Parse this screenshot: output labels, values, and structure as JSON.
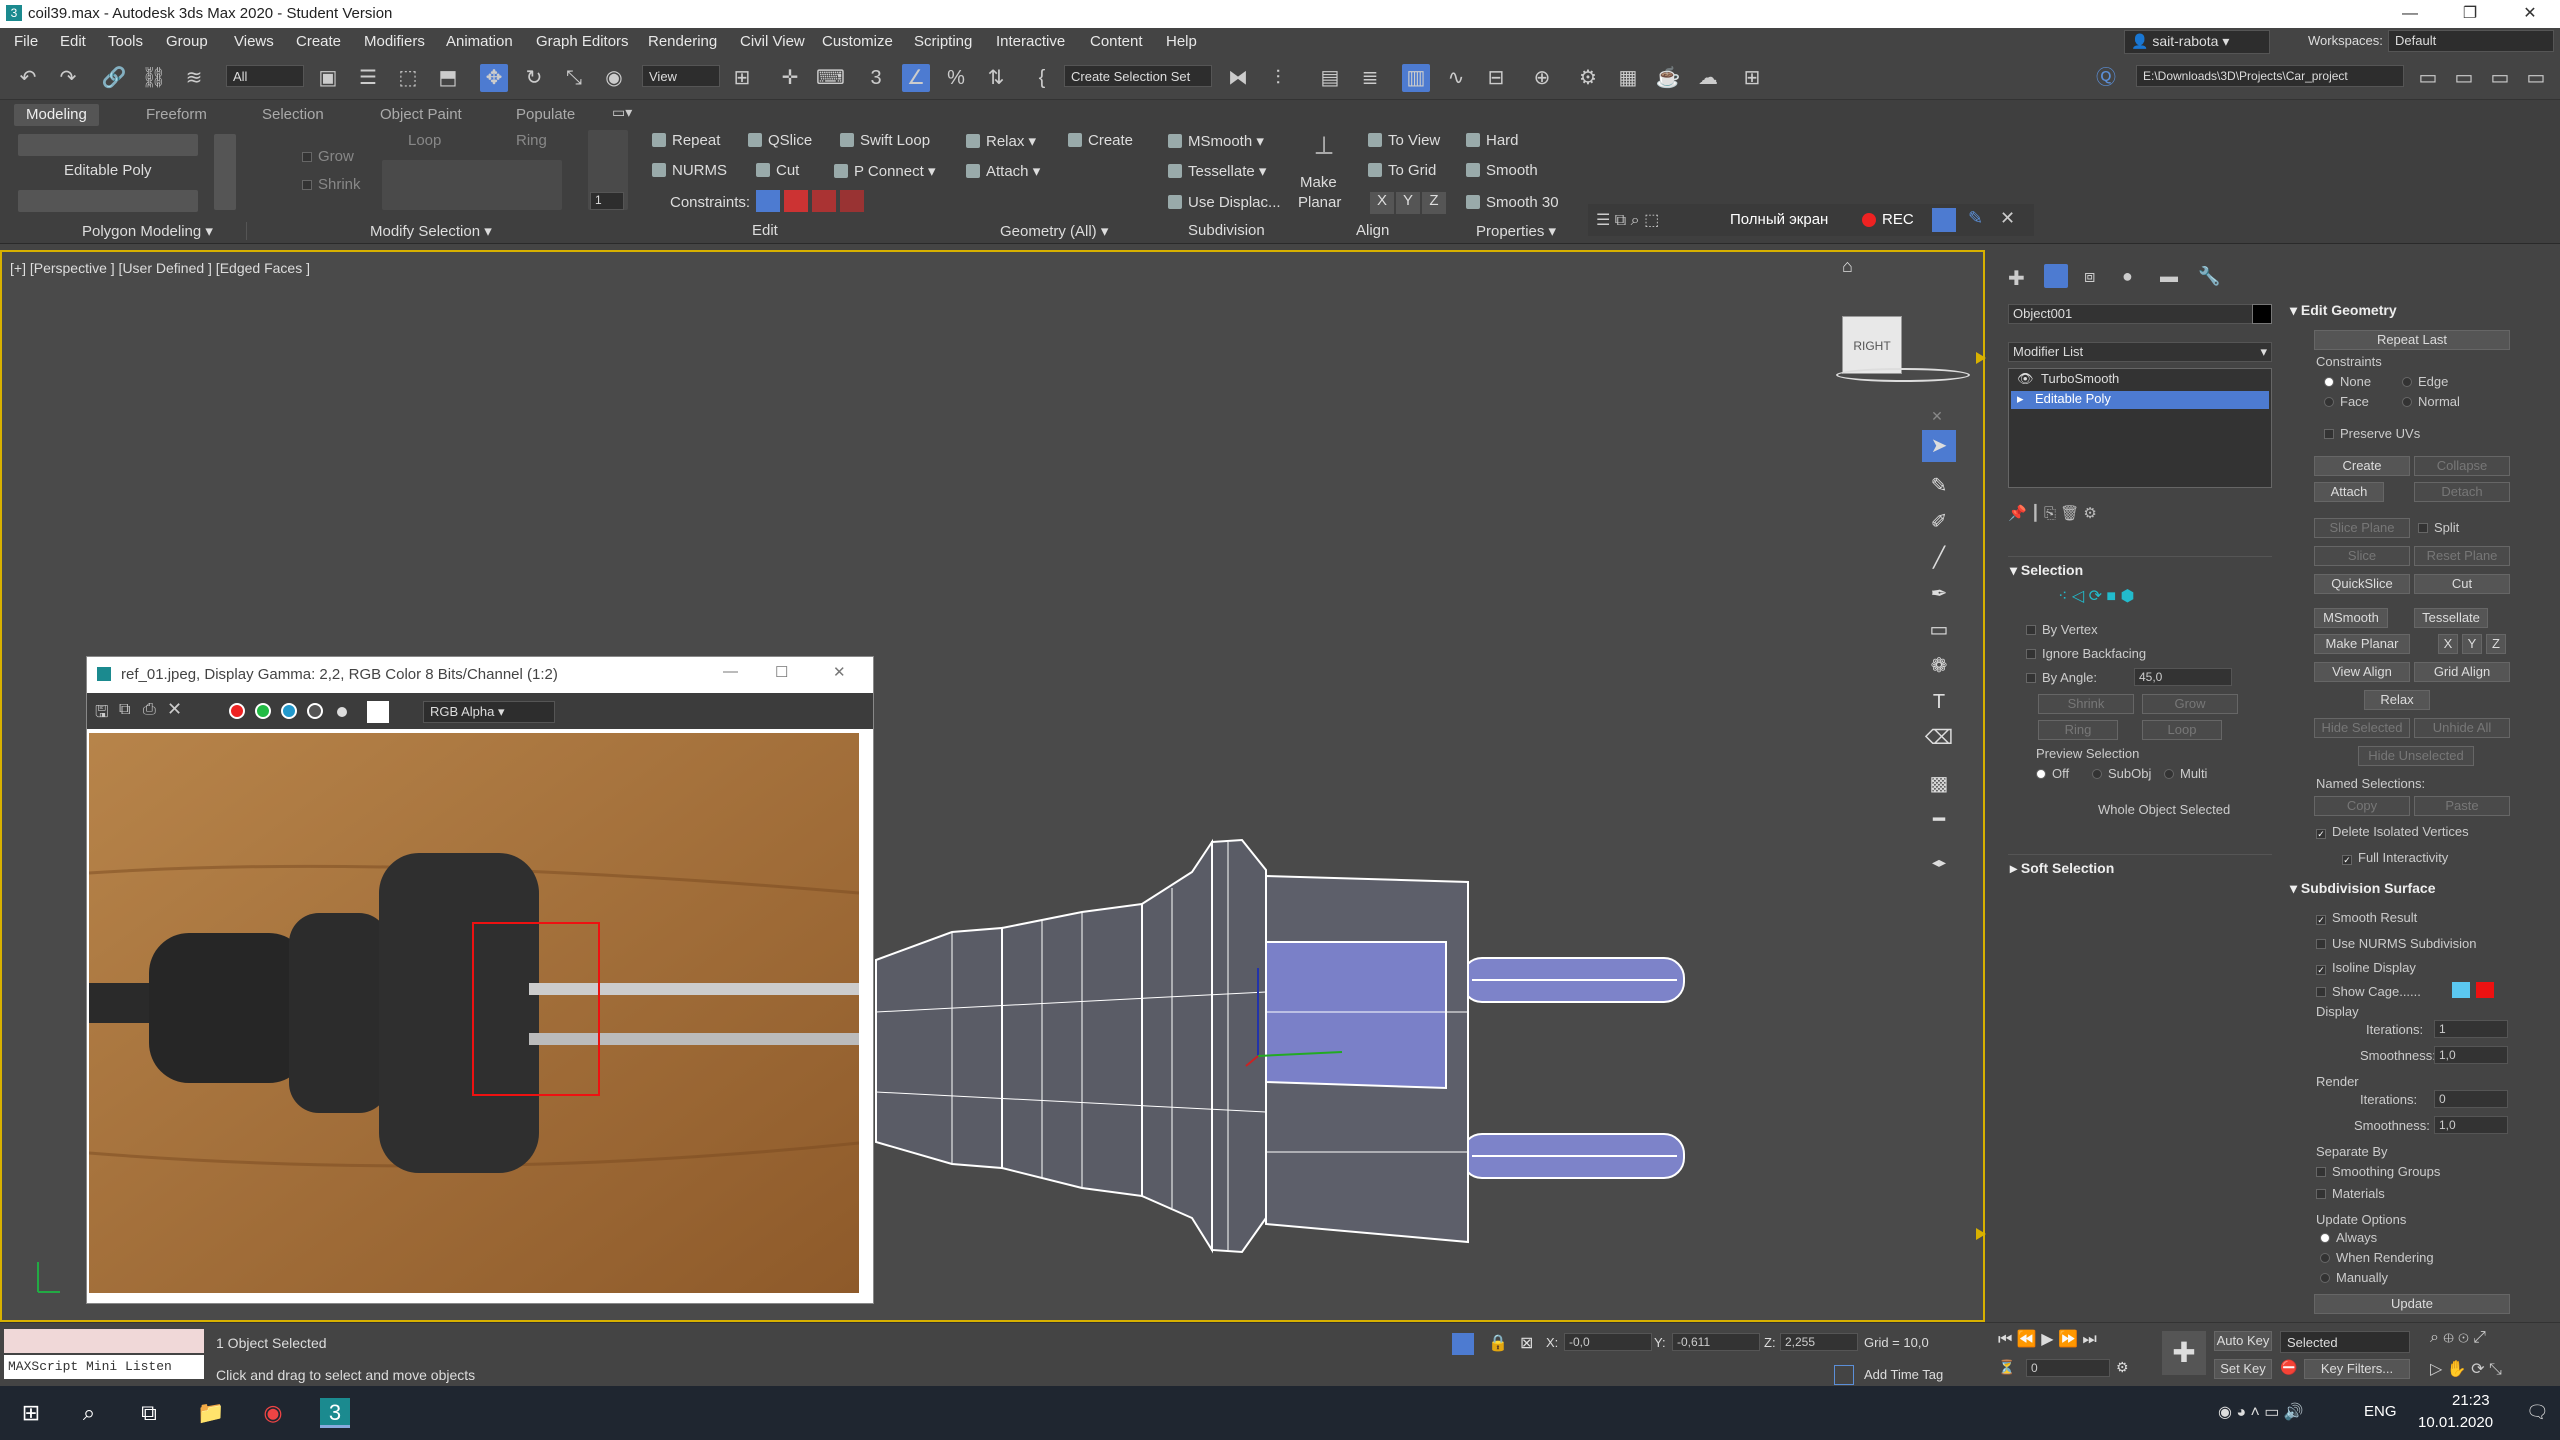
{
  "window": {
    "title": "coil39.max - Autodesk 3ds Max 2020 - Student Version",
    "min": "—",
    "max": "❐",
    "close": "✕"
  },
  "menu": [
    "File",
    "Edit",
    "Tools",
    "Group",
    "Views",
    "Create",
    "Modifiers",
    "Animation",
    "Graph Editors",
    "Rendering",
    "Civil View",
    "Customize",
    "Scripting",
    "Interactive",
    "Content",
    "Help"
  ],
  "user": {
    "name": "sait-rabota",
    "workspaces_label": "Workspaces:",
    "workspace": "Default"
  },
  "toolbar": {
    "filter": "All",
    "refcoord": "View",
    "selset": "Create Selection Set",
    "path": "E:\\Downloads\\3D\\Projects\\Car_project"
  },
  "ribbon": {
    "tabs": [
      "Modeling",
      "Freeform",
      "Selection",
      "Object Paint",
      "Populate"
    ],
    "editable_poly": "Editable Poly",
    "grow": "Grow",
    "shrink": "Shrink",
    "loop": "Loop",
    "ring": "Ring",
    "repeat": "Repeat",
    "qslice": "QSlice",
    "swiftloop": "Swift Loop",
    "nurms": "NURMS",
    "cut": "Cut",
    "pconnect": "P Connect",
    "constraints": "Constraints:",
    "relax": "Relax",
    "create": "Create",
    "attach": "Attach",
    "msmooth": "MSmooth",
    "tessellate": "Tessellate",
    "usedisplac": "Use Displac...",
    "makeplanar_1": "Make",
    "makeplanar_2": "Planar",
    "toview": "To View",
    "togrid": "To Grid",
    "x": "X",
    "y": "Y",
    "z": "Z",
    "hard": "Hard",
    "smooth": "Smooth",
    "smooth30": "Smooth 30",
    "spinner": "1",
    "groups": [
      "Polygon Modeling",
      "Modify Selection",
      "Edit",
      "Geometry (All)",
      "Subdivision",
      "Align",
      "Properties"
    ],
    "overlay_full": "Полный экран",
    "overlay_rec": "REC"
  },
  "viewport": {
    "label": "[+] [Perspective ] [User Defined ] [Edged Faces ]",
    "viewcube": "RIGHT"
  },
  "refwin": {
    "title": "ref_01.jpeg, Display Gamma: 2,2, RGB Color 8 Bits/Channel (1:2)",
    "channel": "RGB Alpha"
  },
  "cmd": {
    "object_name": "Object001",
    "modifier_list": "Modifier List",
    "stack": [
      "TurboSmooth",
      "Editable Poly"
    ],
    "selection": {
      "title": "Selection",
      "by_vertex": "By Vertex",
      "ignore_back": "Ignore Backfacing",
      "by_angle": "By Angle:",
      "angle": "45,0",
      "shrink": "Shrink",
      "grow": "Grow",
      "ring": "Ring",
      "loop": "Loop",
      "preview": "Preview Selection",
      "off": "Off",
      "subobj": "SubObj",
      "multi": "Multi",
      "status": "Whole Object Selected"
    },
    "soft": "Soft Selection",
    "editgeo": {
      "title": "Edit Geometry",
      "repeat": "Repeat Last",
      "constraints": "Constraints",
      "none": "None",
      "edge": "Edge",
      "face": "Face",
      "normal": "Normal",
      "preserve": "Preserve UVs",
      "create": "Create",
      "collapse": "Collapse",
      "attach": "Attach",
      "detach": "Detach",
      "sliceplane": "Slice Plane",
      "split": "Split",
      "slice": "Slice",
      "resetplane": "Reset Plane",
      "quickslice": "QuickSlice",
      "cut": "Cut",
      "msmooth": "MSmooth",
      "tessellate": "Tessellate",
      "makeplanar": "Make Planar",
      "x": "X",
      "y": "Y",
      "z": "Z",
      "viewalign": "View Align",
      "gridalign": "Grid Align",
      "relax": "Relax",
      "hidesel": "Hide Selected",
      "unhideall": "Unhide All",
      "hideunsel": "Hide Unselected",
      "namedsel": "Named Selections:",
      "copy": "Copy",
      "paste": "Paste",
      "deliso": "Delete Isolated Vertices",
      "fullint": "Full Interactivity"
    },
    "subdiv": {
      "title": "Subdivision Surface",
      "smooth": "Smooth Result",
      "nurms": "Use NURMS Subdivision",
      "isoline": "Isoline Display",
      "cage": "Show Cage......",
      "display": "Display",
      "iter": "Iterations:",
      "iter_val": "1",
      "smooth_l": "Smoothness:",
      "smooth_val": "1,0",
      "render": "Render",
      "riter_val": "0",
      "rsmooth_val": "1,0",
      "separate": "Separate By",
      "sg": "Smoothing Groups",
      "mat": "Materials",
      "update": "Update Options",
      "always": "Always",
      "whenrender": "When Rendering",
      "manually": "Manually",
      "updatebtn": "Update"
    }
  },
  "status": {
    "maxscript": "MAXScript Mini Listen",
    "selected": "1 Object Selected",
    "hint": "Click and drag to select and move objects",
    "x_label": "X:",
    "x": "-0,0",
    "y_label": "Y:",
    "y": "-0,611",
    "z_label": "Z:",
    "z": "2,255",
    "grid": "Grid = 10,0",
    "addtime": "Add Time Tag",
    "autokey": "Auto Key",
    "setkey": "Set Key",
    "selected_dd": "Selected",
    "keyfilters": "Key Filters...",
    "frame": "0"
  },
  "taskbar": {
    "lang": "ENG",
    "time": "21:23",
    "date": "10.01.2020"
  },
  "colors": {
    "accent": "#d8b100",
    "selection": "#4d7bd1"
  }
}
